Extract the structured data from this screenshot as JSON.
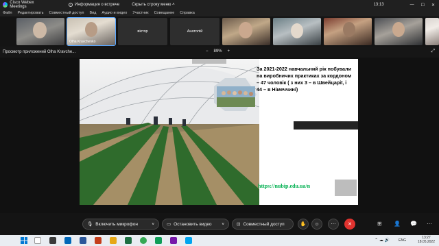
{
  "titlebar": {
    "app_name": "Cisco Webex Meetings",
    "info_label": "Информация о встрече",
    "hide_menu_label": "Скрыть строку меню",
    "time": "13:13"
  },
  "menu": [
    "Файл",
    "Редактировать",
    "Совместный доступ",
    "Вид",
    "Аудио и видео",
    "Участник",
    "Совещание",
    "Справка"
  ],
  "participants": [
    {
      "name": ""
    },
    {
      "name": "Olha Kravchenko"
    },
    {
      "name": "віктор"
    },
    {
      "name": "Анатолій"
    },
    {
      "name": ""
    },
    {
      "name": ""
    },
    {
      "name": ""
    },
    {
      "name": ""
    },
    {
      "name": ""
    }
  ],
  "share_view": {
    "label": "Просмотр приложений Olha Kravche...",
    "zoom_out": "−",
    "zoom": "89%",
    "zoom_in": "+"
  },
  "slide": {
    "text": "За 2021-2022 навчальний рік побували на виробничих практиках за кордоном – 47 чоловік ( з них 3 – в Швейцарії, і 44 – в Німеччині)",
    "link": "https://nubip.edu.ua/n"
  },
  "controls": {
    "mic_label": "Включить микрофон",
    "video_label": "Остановить видео",
    "share_label": "Совместный доступ"
  },
  "taskbar": {
    "lang": "ENG",
    "time": "13:27",
    "date": "18.05.2022"
  },
  "colors": {
    "end_call": "#e0332f",
    "link_green": "#00b050",
    "active_outline": "#5aa7ff"
  }
}
